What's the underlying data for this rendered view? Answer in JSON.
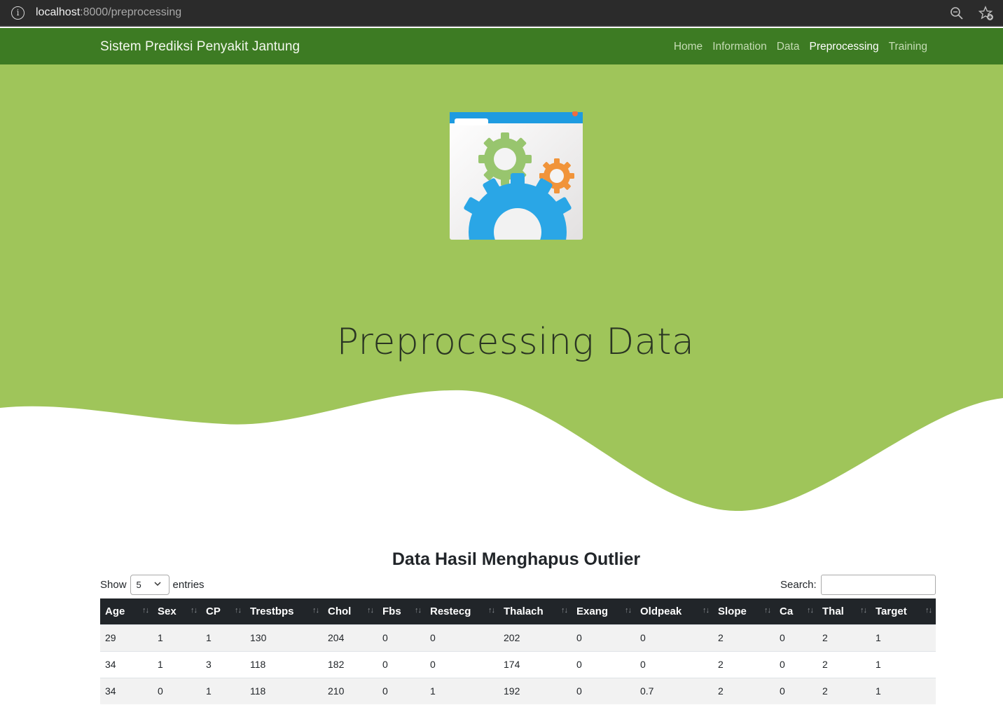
{
  "browser": {
    "url_host": "localhost",
    "url_rest": ":8000/preprocessing"
  },
  "navbar": {
    "brand": "Sistem Prediksi Penyakit Jantung",
    "links": [
      "Home",
      "Information",
      "Data",
      "Preprocessing",
      "Training"
    ],
    "active": "Preprocessing"
  },
  "hero": {
    "title": "Preprocessing Data",
    "icon": "gears-window-icon"
  },
  "section": {
    "title": "Data Hasil Menghapus Outlier",
    "show_label": "Show",
    "entries_value": "5",
    "entries_label": "entries",
    "search_label": "Search:",
    "search_value": ""
  },
  "table": {
    "columns": [
      "Age",
      "Sex",
      "CP",
      "Trestbps",
      "Chol",
      "Fbs",
      "Restecg",
      "Thalach",
      "Exang",
      "Oldpeak",
      "Slope",
      "Ca",
      "Thal",
      "Target"
    ],
    "rows": [
      [
        "29",
        "1",
        "1",
        "130",
        "204",
        "0",
        "0",
        "202",
        "0",
        "0",
        "2",
        "0",
        "2",
        "1"
      ],
      [
        "34",
        "1",
        "3",
        "118",
        "182",
        "0",
        "0",
        "174",
        "0",
        "0",
        "2",
        "0",
        "2",
        "1"
      ],
      [
        "34",
        "0",
        "1",
        "118",
        "210",
        "0",
        "1",
        "192",
        "0",
        "0.7",
        "2",
        "0",
        "2",
        "1"
      ]
    ]
  },
  "colors": {
    "navbar": "#3d7b23",
    "hero": "#9fc55a",
    "table_header": "#212529"
  }
}
